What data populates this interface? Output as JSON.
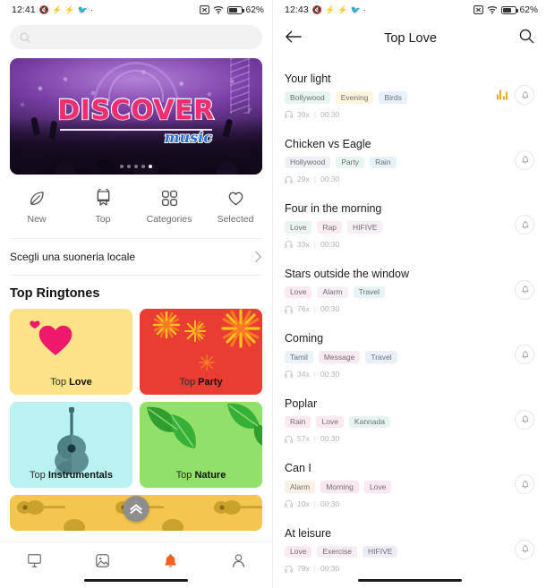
{
  "left": {
    "statusbar": {
      "time": "12:41",
      "icons": [
        "mute-icon",
        "sync-icon",
        "sync-icon",
        "twitter-icon",
        "dot-icon"
      ],
      "right_icons": [
        "no-sim-icon",
        "wifi-icon",
        "battery-icon"
      ],
      "battery_percent": "62%"
    },
    "search": {
      "placeholder": "",
      "value": "",
      "icon": "search-icon"
    },
    "banner": {
      "title": "DISCOVER",
      "subtitle": "music",
      "dots": 5,
      "active_dot": 5
    },
    "quicknav": [
      {
        "label": "New",
        "icon": "leaf-icon"
      },
      {
        "label": "Top",
        "icon": "ribbon-icon"
      },
      {
        "label": "Categories",
        "icon": "grid-icon"
      },
      {
        "label": "Selected",
        "icon": "heart-icon"
      }
    ],
    "local_row": {
      "label": "Scegli una suoneria locale",
      "icon": "chevron-right-icon"
    },
    "section_title": "Top Ringtones",
    "cards": [
      {
        "prefix": "Top",
        "name": "Love",
        "color": "#fce38a",
        "icon": "heart-icon"
      },
      {
        "prefix": "Top",
        "name": "Party",
        "color": "#e93c33",
        "icon": "fireworks-icon"
      },
      {
        "prefix": "Top",
        "name": "Instrumentals",
        "color": "#b9f2f0",
        "icon": "guitar-icon"
      },
      {
        "prefix": "Top",
        "name": "Nature",
        "color": "#90e06a",
        "icon": "leaf-icon"
      }
    ],
    "fab": {
      "icon": "double-chevron-up-icon"
    },
    "bottomnav": [
      {
        "icon": "wallpaper-icon",
        "active": false
      },
      {
        "icon": "image-icon",
        "active": false
      },
      {
        "icon": "bell-icon",
        "active": true
      },
      {
        "icon": "person-icon",
        "active": false
      }
    ],
    "accent_color": "#f4611f"
  },
  "right": {
    "statusbar": {
      "time": "12:43",
      "battery_percent": "62%"
    },
    "appbar": {
      "back_icon": "arrow-left-icon",
      "title": "Top Love",
      "search_icon": "search-icon"
    },
    "tracks": [
      {
        "name": "Your light",
        "tags": [
          "Bollywood",
          "Evening",
          "Birds"
        ],
        "tag_colors": [
          "#e6f5f2",
          "#fdf6df",
          "#e8f0fb"
        ],
        "plays": "39x",
        "duration": "00:30",
        "playing": true,
        "bell_icon": "bell-icon"
      },
      {
        "name": "Chicken vs Eagle",
        "tags": [
          "Hollywood",
          "Party",
          "Rain"
        ],
        "tag_colors": [
          "#eef2f8",
          "#e9f5f3",
          "#e6f2f8"
        ],
        "plays": "29x",
        "duration": "00:30",
        "playing": false,
        "bell_icon": "bell-icon"
      },
      {
        "name": "Four in the morning",
        "tags": [
          "Love",
          "Rap",
          "HIFIVE"
        ],
        "tag_colors": [
          "#eaf4f1",
          "#fbebf3",
          "#f6eff6"
        ],
        "plays": "33x",
        "duration": "00:30",
        "playing": false,
        "bell_icon": "bell-icon"
      },
      {
        "name": "Stars outside the window",
        "tags": [
          "Love",
          "Alarm",
          "Travel"
        ],
        "tag_colors": [
          "#fbeaf3",
          "#f7f0f7",
          "#e6f3f7"
        ],
        "plays": "76x",
        "duration": "00:30",
        "playing": false,
        "bell_icon": "bell-icon"
      },
      {
        "name": "Coming",
        "tags": [
          "Tamil",
          "Message",
          "Travel"
        ],
        "tag_colors": [
          "#e9f3f8",
          "#f7eaf3",
          "#eaf0f9"
        ],
        "plays": "34x",
        "duration": "00:30",
        "playing": false,
        "bell_icon": "bell-icon"
      },
      {
        "name": "Poplar",
        "tags": [
          "Rain",
          "Love",
          "Kannada"
        ],
        "tag_colors": [
          "#fbe9f2",
          "#fbe9f2",
          "#e6f4f4"
        ],
        "plays": "57x",
        "duration": "00:30",
        "playing": false,
        "bell_icon": "bell-icon"
      },
      {
        "name": "Can I",
        "tags": [
          "Alarm",
          "Morning",
          "Love"
        ],
        "tag_colors": [
          "#fdf2e6",
          "#fbe6f1",
          "#fae9f4"
        ],
        "plays": "10x",
        "duration": "00:30",
        "playing": false,
        "bell_icon": "bell-icon"
      },
      {
        "name": "At leisure",
        "tags": [
          "Love",
          "Exercise",
          "HIFIVE"
        ],
        "tag_colors": [
          "#fbeaf3",
          "#f8ecf5",
          "#eeecf9"
        ],
        "plays": "79x",
        "duration": "00:30",
        "playing": false,
        "bell_icon": "bell-icon"
      }
    ],
    "equalizer_color": "#f0a830"
  }
}
